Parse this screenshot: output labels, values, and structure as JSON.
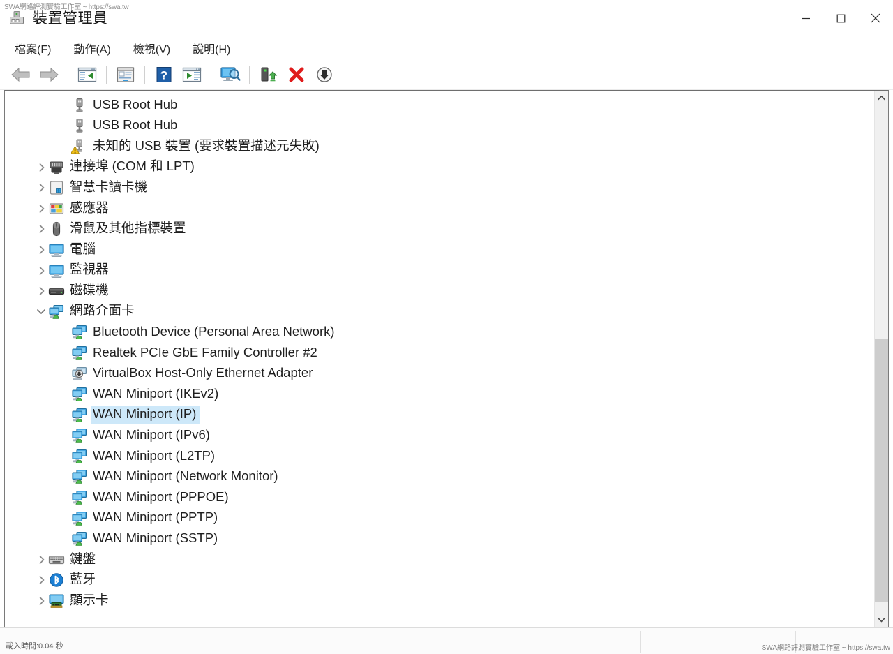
{
  "window": {
    "title": "裝置管理員",
    "icon": "device-manager-icon",
    "controls": {
      "minimize": "—",
      "maximize": "□",
      "close": "✕"
    }
  },
  "watermark": {
    "top": "SWA網路評測實驗工作室 ~ https://swa.tw",
    "bottom": "SWA網路評測實驗工作室 ~ https://swa.tw"
  },
  "menubar": {
    "items": [
      {
        "label": "檔案",
        "accel": "F",
        "name": "menu-file"
      },
      {
        "label": "動作",
        "accel": "A",
        "name": "menu-action"
      },
      {
        "label": "檢視",
        "accel": "V",
        "name": "menu-view"
      },
      {
        "label": "說明",
        "accel": "H",
        "name": "menu-help"
      }
    ]
  },
  "toolbar": {
    "buttons": [
      {
        "name": "back-button",
        "icon": "back-arrow-icon"
      },
      {
        "name": "forward-button",
        "icon": "forward-arrow-icon"
      },
      {
        "sep": true
      },
      {
        "name": "show-hide-console-tree-button",
        "icon": "console-tree-icon"
      },
      {
        "sep": true
      },
      {
        "name": "properties-button",
        "icon": "properties-window-icon"
      },
      {
        "sep": true
      },
      {
        "name": "help-button",
        "icon": "help-question-icon"
      },
      {
        "name": "show-hide-action-pane-button",
        "icon": "action-pane-icon"
      },
      {
        "sep": true
      },
      {
        "name": "scan-for-hardware-changes-button",
        "icon": "scan-hardware-icon"
      },
      {
        "sep": true
      },
      {
        "name": "update-driver-button",
        "icon": "update-driver-icon"
      },
      {
        "name": "uninstall-device-button",
        "icon": "red-x-icon"
      },
      {
        "name": "disable-device-button",
        "icon": "disable-down-arrow-icon"
      }
    ]
  },
  "tree": {
    "rows": [
      {
        "level": 2,
        "icon": "usb-hub-icon",
        "label": "USB Root Hub",
        "expandable": false,
        "expanded": false,
        "selected": false
      },
      {
        "level": 2,
        "icon": "usb-hub-icon",
        "label": "USB Root Hub",
        "expandable": false,
        "expanded": false,
        "selected": false
      },
      {
        "level": 2,
        "icon": "usb-warning-icon",
        "label": "未知的 USB 裝置 (要求裝置描述元失敗)",
        "expandable": false,
        "expanded": false,
        "selected": false
      },
      {
        "level": 1,
        "icon": "ports-icon",
        "label": "連接埠 (COM 和 LPT)",
        "expandable": true,
        "expanded": false,
        "selected": false
      },
      {
        "level": 1,
        "icon": "smartcard-icon",
        "label": "智慧卡讀卡機",
        "expandable": true,
        "expanded": false,
        "selected": false
      },
      {
        "level": 1,
        "icon": "sensor-icon",
        "label": "感應器",
        "expandable": true,
        "expanded": false,
        "selected": false
      },
      {
        "level": 1,
        "icon": "mouse-icon",
        "label": "滑鼠及其他指標裝置",
        "expandable": true,
        "expanded": false,
        "selected": false
      },
      {
        "level": 1,
        "icon": "computer-icon",
        "label": "電腦",
        "expandable": true,
        "expanded": false,
        "selected": false
      },
      {
        "level": 1,
        "icon": "monitor-icon",
        "label": "監視器",
        "expandable": true,
        "expanded": false,
        "selected": false
      },
      {
        "level": 1,
        "icon": "disk-drive-icon",
        "label": "磁碟機",
        "expandable": true,
        "expanded": false,
        "selected": false
      },
      {
        "level": 1,
        "icon": "network-adapter-icon",
        "label": "網路介面卡",
        "expandable": true,
        "expanded": true,
        "selected": false
      },
      {
        "level": 2,
        "icon": "network-adapter-icon",
        "label": "Bluetooth Device (Personal Area Network)",
        "expandable": false,
        "expanded": false,
        "selected": false
      },
      {
        "level": 2,
        "icon": "network-adapter-icon",
        "label": "Realtek PCIe GbE Family Controller #2",
        "expandable": false,
        "expanded": false,
        "selected": false
      },
      {
        "level": 2,
        "icon": "network-disabled-icon",
        "label": "VirtualBox Host-Only Ethernet Adapter",
        "expandable": false,
        "expanded": false,
        "selected": false
      },
      {
        "level": 2,
        "icon": "network-adapter-icon",
        "label": "WAN Miniport (IKEv2)",
        "expandable": false,
        "expanded": false,
        "selected": false
      },
      {
        "level": 2,
        "icon": "network-adapter-icon",
        "label": "WAN Miniport (IP)",
        "expandable": false,
        "expanded": false,
        "selected": true
      },
      {
        "level": 2,
        "icon": "network-adapter-icon",
        "label": "WAN Miniport (IPv6)",
        "expandable": false,
        "expanded": false,
        "selected": false
      },
      {
        "level": 2,
        "icon": "network-adapter-icon",
        "label": "WAN Miniport (L2TP)",
        "expandable": false,
        "expanded": false,
        "selected": false
      },
      {
        "level": 2,
        "icon": "network-adapter-icon",
        "label": "WAN Miniport (Network Monitor)",
        "expandable": false,
        "expanded": false,
        "selected": false
      },
      {
        "level": 2,
        "icon": "network-adapter-icon",
        "label": "WAN Miniport (PPPOE)",
        "expandable": false,
        "expanded": false,
        "selected": false
      },
      {
        "level": 2,
        "icon": "network-adapter-icon",
        "label": "WAN Miniport (PPTP)",
        "expandable": false,
        "expanded": false,
        "selected": false
      },
      {
        "level": 2,
        "icon": "network-adapter-icon",
        "label": "WAN Miniport (SSTP)",
        "expandable": false,
        "expanded": false,
        "selected": false
      },
      {
        "level": 1,
        "icon": "keyboard-icon",
        "label": "鍵盤",
        "expandable": true,
        "expanded": false,
        "selected": false
      },
      {
        "level": 1,
        "icon": "bluetooth-icon",
        "label": "藍牙",
        "expandable": true,
        "expanded": false,
        "selected": false
      },
      {
        "level": 1,
        "icon": "display-adapter-icon",
        "label": "顯示卡",
        "expandable": true,
        "expanded": false,
        "selected": false
      }
    ]
  },
  "scrollbar": {
    "up_arrow": "▲",
    "down_arrow": "▼",
    "thumb_top_pct": 46,
    "thumb_height_pct": 52
  },
  "statusbar": {
    "left_text": "載入時間:0.04 秒"
  },
  "colors": {
    "selection": "#cde8f9",
    "accent": "#0078d7",
    "panel_border": "#7a7a7a",
    "scrollbar_thumb": "#cdcdcd"
  }
}
